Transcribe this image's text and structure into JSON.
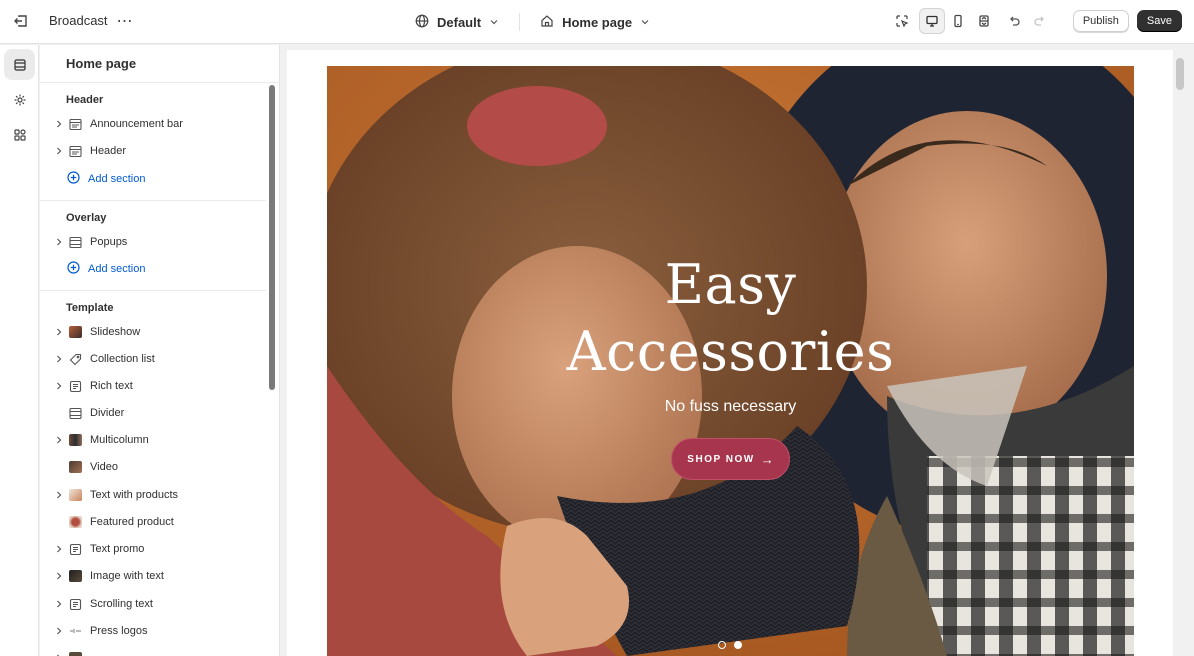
{
  "topbar": {
    "theme_name": "Broadcast",
    "more_icon": "⋯",
    "view_select": "Default",
    "page_select": "Home page",
    "publish_label": "Publish",
    "save_label": "Save"
  },
  "panel": {
    "title": "Home page",
    "header_group": {
      "label": "Header",
      "items": [
        {
          "label": "Announcement bar"
        },
        {
          "label": "Header"
        }
      ],
      "add_label": "Add section"
    },
    "overlay_group": {
      "label": "Overlay",
      "items": [
        {
          "label": "Popups"
        }
      ],
      "add_label": "Add section"
    },
    "template_group": {
      "label": "Template",
      "items": [
        {
          "label": "Slideshow"
        },
        {
          "label": "Collection list"
        },
        {
          "label": "Rich text"
        },
        {
          "label": "Divider"
        },
        {
          "label": "Multicolumn"
        },
        {
          "label": "Video"
        },
        {
          "label": "Text with products"
        },
        {
          "label": "Featured product"
        },
        {
          "label": "Text promo"
        },
        {
          "label": "Image with text"
        },
        {
          "label": "Scrolling text"
        },
        {
          "label": "Press logos"
        }
      ]
    }
  },
  "hero": {
    "title_line1": "Easy",
    "title_line2": "Accessories",
    "subtitle": "No fuss necessary",
    "button_label": "SHOP NOW",
    "button_arrow": "→",
    "slides_total": 2,
    "active_slide": 2
  },
  "colors": {
    "accent_blue": "#005bd3",
    "hero_background": "#c06a2e",
    "cta_color": "#a8354e",
    "save_button": "#303030"
  }
}
